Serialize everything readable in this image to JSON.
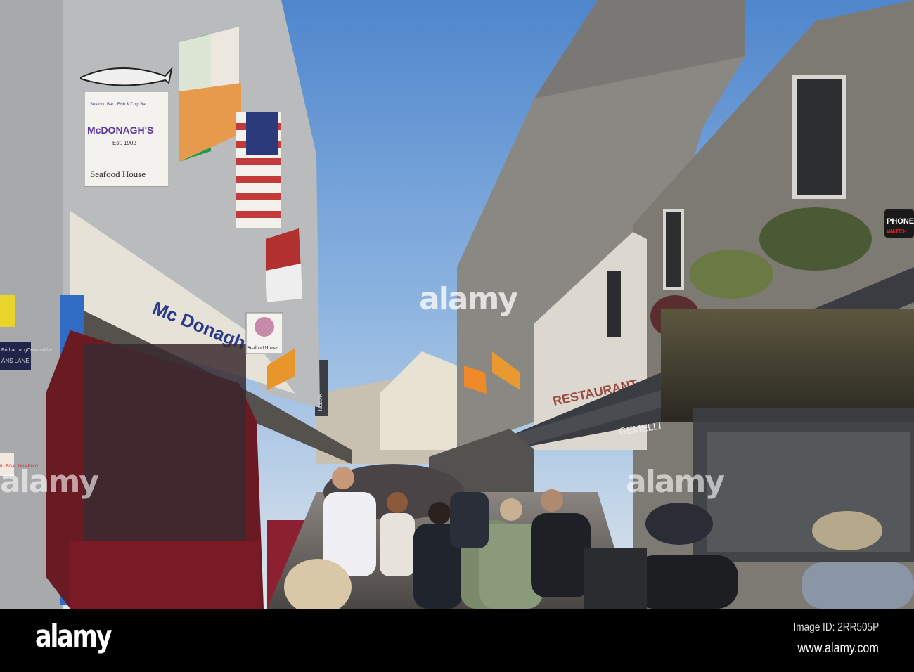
{
  "photo": {
    "signs": {
      "seafood_top": "Seafood Bar · Fish & Chip Bar",
      "mcdonaghs": "McDONAGH'S",
      "est": "Est. 1902",
      "seafood_house": "Seafood House",
      "seafood_house_small": "Seafood House",
      "shopfront": "Mc Donagh's",
      "street_sign_irish": "Bóthar na gCeannaithe",
      "street_sign": "ANS LANE",
      "warning_sign": "ILLEGAL DUMPING",
      "hotel": "HOTEL",
      "restaurant": "RESTAURANT",
      "gemelli": "GEMELLI",
      "phone": "PHONE",
      "phone_sub": "WATCH"
    },
    "watermark": "alamy"
  },
  "footer": {
    "logo": "alamy",
    "image_id": "Image ID: 2RR505P",
    "url": "www.alamy.com"
  },
  "colors": {
    "sky": "#6f9fd8",
    "stone": "#7d7a74",
    "awning": "#2e3036"
  }
}
